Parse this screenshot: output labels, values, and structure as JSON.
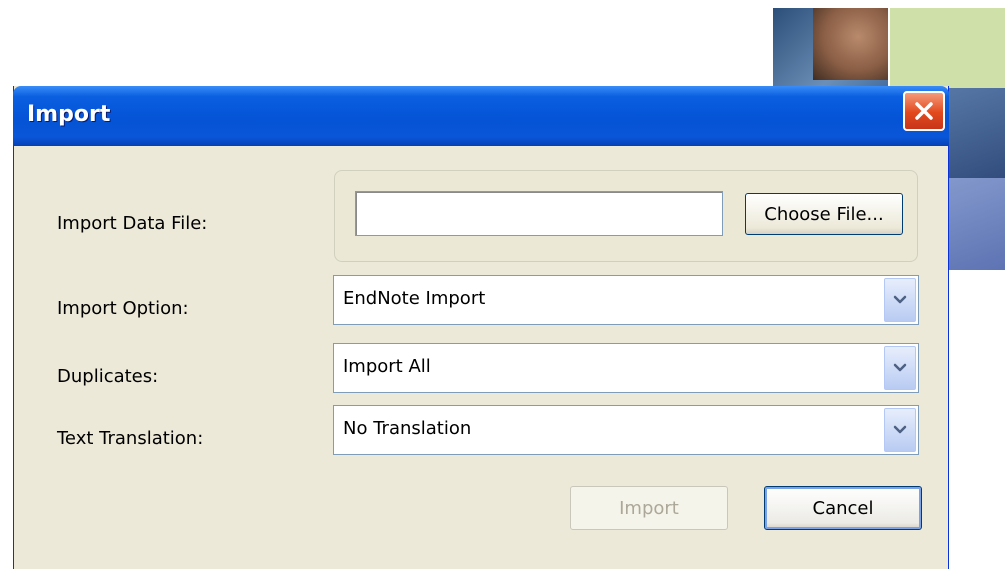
{
  "dialog": {
    "title": "Import"
  },
  "form": {
    "data_file_label": "Import Data File:",
    "data_file_value": "",
    "choose_file_label": "Choose File...",
    "import_option_label": "Import Option:",
    "import_option_value": "EndNote Import",
    "duplicates_label": "Duplicates:",
    "duplicates_value": "Import All",
    "text_translation_label": "Text Translation:",
    "text_translation_value": "No Translation"
  },
  "buttons": {
    "import_label": "Import",
    "cancel_label": "Cancel"
  },
  "icons": {
    "close": "close-icon",
    "dropdown": "chevron-down-icon"
  },
  "colors": {
    "title_bar": "#0553d6",
    "dialog_bg": "#ece9d8",
    "close_button": "#e2491d",
    "disabled_text": "#aca899"
  }
}
